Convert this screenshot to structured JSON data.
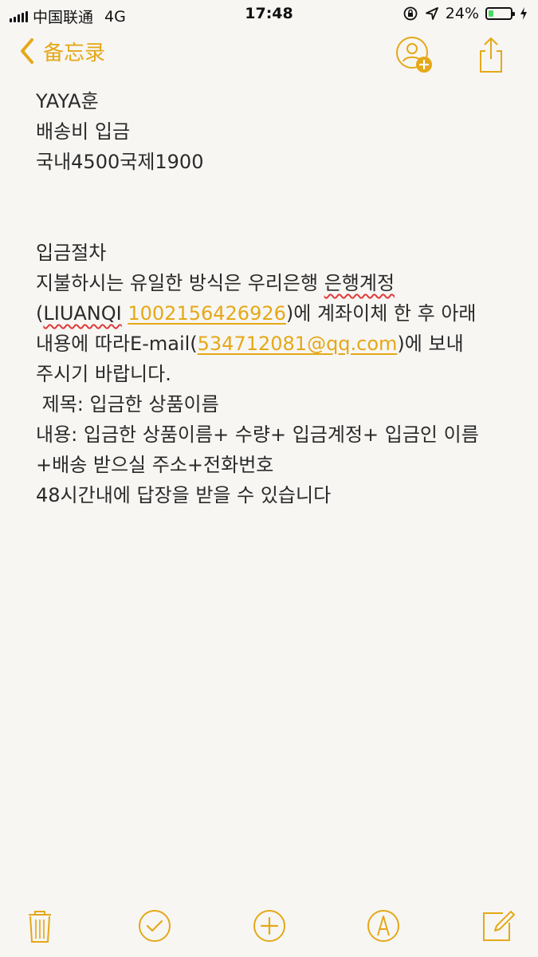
{
  "status_bar": {
    "carrier": "中国联通",
    "network": "4G",
    "time": "17:48",
    "battery_percent": "24%",
    "battery_level": 0.24
  },
  "nav": {
    "back_label": "备忘录",
    "accent_color": "#e5a818"
  },
  "note": {
    "line1": "YAYA훈",
    "line2": "배송비 입금",
    "line3": "국내4500국제1900",
    "line4": "입금절차",
    "line5_a": "지불하시는 유일한 방식은 우리은행 ",
    "line5_b": "은행계정",
    "line6_a": "(",
    "line6_b": "LIUANQI",
    "line6_c": " ",
    "line6_link": "1002156426926",
    "line6_d": ")에 계좌이체 한 후 아래",
    "line7_a": "내용에 따라E-mail(",
    "line7_link": "534712081@qq.com",
    "line7_b": ")에 보내",
    "line8": "주시기 바랍니다.",
    "line9": " 제목: 입금한 상품이름",
    "line10": "내용: 입금한 상품이름+ 수량+ 입금계정+ 입금인 이름",
    "line11": "+배송 받으실 주소+전화번호",
    "line12": "48시간내에 답장을 받을 수 있습니다"
  },
  "icons": {
    "back": "chevron-left-icon",
    "add_person": "add-person-icon",
    "share": "share-icon",
    "trash": "trash-icon",
    "checklist": "checklist-icon",
    "add": "plus-icon",
    "markup": "markup-icon",
    "compose": "compose-icon"
  }
}
